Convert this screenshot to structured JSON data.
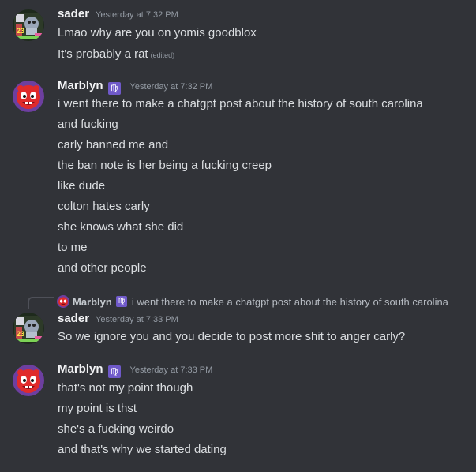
{
  "messages": [
    {
      "username": "sader",
      "timestamp": "Yesterday at 7:32 PM",
      "avatar_icon": "sader-avatar-icon",
      "lines": [
        "Lmao why are you on yomis goodblox",
        "It's probably a rat"
      ],
      "edited_label": "(edited)"
    },
    {
      "username": "Marblyn",
      "role_icon": "♍",
      "timestamp": "Yesterday at 7:32 PM",
      "avatar_icon": "marblyn-avatar-icon",
      "lines": [
        "i went there to make a chatgpt post about the history of south carolina",
        "and fucking",
        "carly banned me and",
        "the ban note is her being a fucking creep",
        "like dude",
        "colton hates carly",
        "she knows what she did",
        "to me",
        "and other people"
      ]
    },
    {
      "reply_to": {
        "username": "Marblyn",
        "role_icon": "♍",
        "text": "i went there to make a chatgpt post about the history of south carolina"
      },
      "username": "sader",
      "timestamp": "Yesterday at 7:33 PM",
      "avatar_icon": "sader-avatar-icon",
      "lines": [
        "So we ignore you and you decide to post more shit to anger carly?"
      ]
    },
    {
      "username": "Marblyn",
      "role_icon": "♍",
      "timestamp": "Yesterday at 7:33 PM",
      "avatar_icon": "marblyn-avatar-icon",
      "lines": [
        "that's not my point though",
        "my point is thst",
        "she's a fucking weirdo",
        "and that's why we started dating"
      ]
    }
  ],
  "colors": {
    "background": "#313338",
    "text": "#dbdee1",
    "username": "#f2f3f5",
    "timestamp": "#949ba4",
    "role_badge": "#6f59c9"
  }
}
